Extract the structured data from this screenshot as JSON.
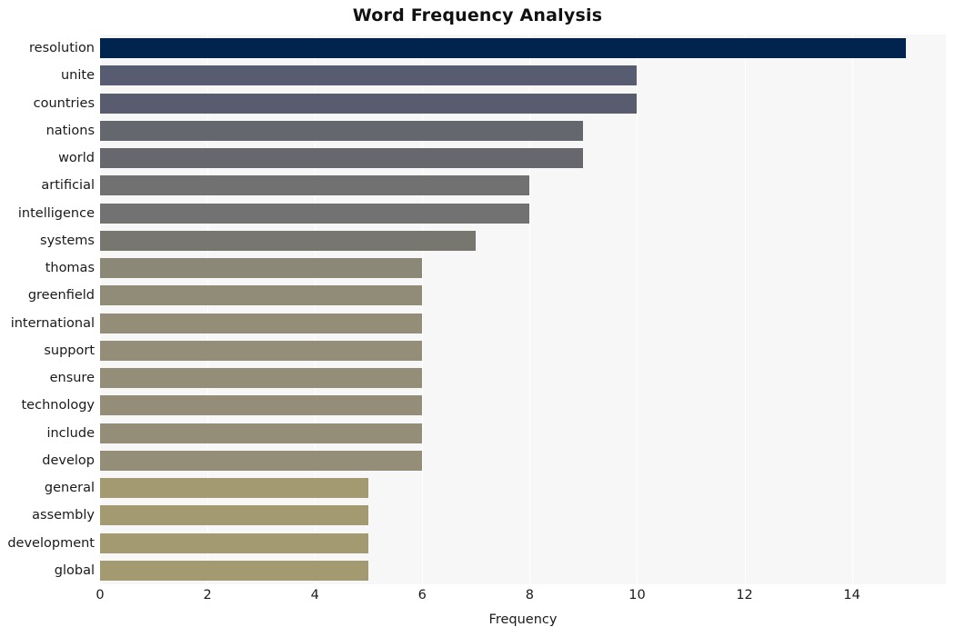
{
  "chart_data": {
    "type": "bar",
    "orientation": "horizontal",
    "title": "Word Frequency Analysis",
    "xlabel": "Frequency",
    "ylabel": "",
    "xlim": [
      0,
      15.75
    ],
    "grid": true,
    "legend": null,
    "xticks": [
      0,
      2,
      4,
      6,
      8,
      10,
      12,
      14
    ],
    "xtick_labels": [
      "0",
      "2",
      "4",
      "6",
      "8",
      "10",
      "12",
      "14"
    ],
    "categories": [
      "resolution",
      "unite",
      "countries",
      "nations",
      "world",
      "artificial",
      "intelligence",
      "systems",
      "thomas",
      "greenfield",
      "international",
      "support",
      "ensure",
      "technology",
      "include",
      "develop",
      "general",
      "assembly",
      "development",
      "global"
    ],
    "values": [
      15,
      10,
      10,
      9,
      9,
      8,
      8,
      7,
      6,
      6,
      6,
      6,
      6,
      6,
      6,
      6,
      5,
      5,
      5,
      5
    ],
    "bar_colors": [
      "#00244d",
      "#575c70",
      "#585c6e",
      "#65676e",
      "#66686d",
      "#717171",
      "#727272",
      "#777770",
      "#8c8878",
      "#918c78",
      "#948e78",
      "#948e78",
      "#948e78",
      "#948e78",
      "#948e78",
      "#948e78",
      "#a39a72",
      "#a39a72",
      "#a39a72",
      "#a39a72"
    ],
    "plot_bg_color": "#f7f7f8",
    "gridline_color": "#ffffff",
    "figure_bg_color": "#ffffff"
  }
}
